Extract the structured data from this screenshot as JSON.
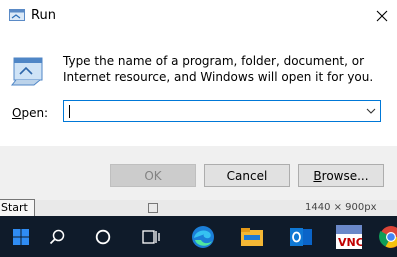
{
  "dialog": {
    "title": "Run",
    "description": "Type the name of a program, folder, document, or Internet resource, and Windows will open it for you.",
    "open_label_accel": "O",
    "open_label_rest": "pen:",
    "open_value": "",
    "buttons": {
      "ok": "OK",
      "cancel": "Cancel",
      "browse_accel": "B",
      "browse_rest": "rowse..."
    }
  },
  "background": {
    "size_text": "1440 × 900px"
  },
  "tooltip": {
    "text": "Start"
  },
  "taskbar": {
    "items": [
      {
        "icon": "windows-start-icon"
      },
      {
        "icon": "search-icon"
      },
      {
        "icon": "cortana-icon"
      },
      {
        "icon": "task-view-icon"
      },
      {
        "icon": "edge-icon"
      },
      {
        "icon": "file-explorer-icon"
      },
      {
        "icon": "outlook-icon"
      },
      {
        "icon": "vnc-viewer-icon"
      },
      {
        "icon": "chrome-icon"
      }
    ]
  },
  "colors": {
    "focus_border": "#0078d7",
    "taskbar": "#0f1b2a"
  }
}
